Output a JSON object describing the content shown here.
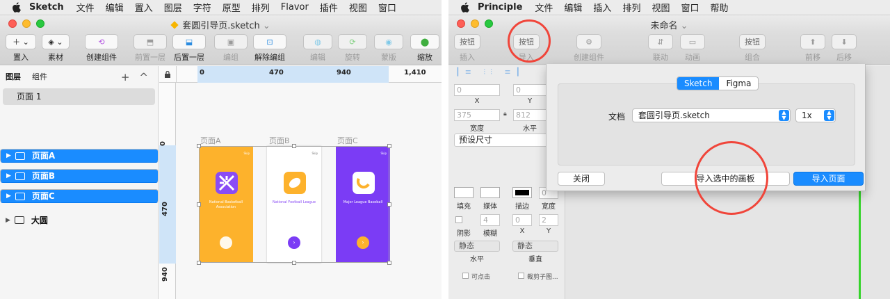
{
  "sketch": {
    "menubar": {
      "app": "Sketch",
      "items": [
        "文件",
        "编辑",
        "置入",
        "图层",
        "字符",
        "原型",
        "排列",
        "Flavor",
        "插件",
        "视图",
        "窗口"
      ]
    },
    "window": {
      "doc_title": "套圆引导页.sketch",
      "doc_chev": "⌄"
    },
    "toolbar": [
      {
        "label": "置入",
        "icon": "plus-icon",
        "enabled": true
      },
      {
        "label": "素材",
        "icon": "layers-icon",
        "enabled": true
      },
      {
        "label": "创建组件",
        "icon": "symbol-icon",
        "enabled": true
      },
      {
        "label": "前置一层",
        "icon": "bring-forward-icon",
        "enabled": false
      },
      {
        "label": "后置一层",
        "icon": "send-backward-icon",
        "enabled": true
      },
      {
        "label": "编组",
        "icon": "group-icon",
        "enabled": false
      },
      {
        "label": "解除编组",
        "icon": "ungroup-icon",
        "enabled": true
      },
      {
        "label": "编辑",
        "icon": "edit-icon",
        "enabled": false
      },
      {
        "label": "旋转",
        "icon": "rotate-icon",
        "enabled": false
      },
      {
        "label": "蒙版",
        "icon": "mask-icon",
        "enabled": false
      },
      {
        "label": "缩放",
        "icon": "scale-icon",
        "enabled": true
      }
    ],
    "sidebar": {
      "tabs": [
        "图层",
        "组件"
      ],
      "add": "+",
      "collapse": "^",
      "page": "页面 1",
      "layers": [
        {
          "name": "页面A",
          "selected": true
        },
        {
          "name": "页面B",
          "selected": true
        },
        {
          "name": "页面C",
          "selected": true
        },
        {
          "name": "大圆",
          "selected": false
        }
      ]
    },
    "ruler": {
      "h": [
        "0",
        "470",
        "940",
        "1,410"
      ],
      "v": [
        "0",
        "470",
        "940"
      ]
    },
    "artboards": [
      {
        "label": "页面A",
        "caption": "National Basketball Association",
        "bg": "#fdb22c",
        "skip": "Skip"
      },
      {
        "label": "页面B",
        "caption": "National Football League",
        "bg": "#ffffff",
        "skip": "Skip"
      },
      {
        "label": "页面C",
        "caption": "Major League Baseball",
        "bg": "#7b3cf5",
        "skip": "Skip"
      }
    ]
  },
  "principle": {
    "menubar": {
      "app": "Principle",
      "items": [
        "文件",
        "编辑",
        "插入",
        "排列",
        "视图",
        "窗口",
        "帮助"
      ]
    },
    "window": {
      "doc_title": "未命名",
      "doc_chev": "⌄"
    },
    "toolbar": [
      {
        "button": "按钮",
        "label": "插入"
      },
      {
        "button": "按钮",
        "label": "导入"
      },
      {
        "button": "",
        "label": "创建组件"
      },
      {
        "button": "",
        "label": "联动"
      },
      {
        "button": "",
        "label": "动画"
      },
      {
        "button": "按钮",
        "label": "组合"
      },
      {
        "button": "",
        "label": "前移"
      },
      {
        "button": "",
        "label": "后移"
      }
    ],
    "inspector": {
      "x": "0",
      "y": "0",
      "x_label": "X",
      "y_label": "Y",
      "w": "375",
      "h": "812",
      "w_label": "宽度",
      "h_label": "水平",
      "preset": "预设尺寸",
      "fill": "填充",
      "media": "媒体",
      "stroke": "描边",
      "stroke_w": "宽度",
      "stroke_val": "0",
      "shadow": "阴影",
      "blur": "模糊",
      "blur_val": "4",
      "sx": "0",
      "sy": "2",
      "sx_label": "X",
      "sy_label": "Y",
      "h_align": "静态",
      "v_align": "静态",
      "v_label": "垂直",
      "clickable": "可点击",
      "clip": "裁剪子图..."
    },
    "dialog": {
      "tabs": [
        "Sketch",
        "Figma"
      ],
      "active_tab": "Sketch",
      "doc_label": "文档",
      "doc_value": "套圆引导页.sketch",
      "scale": "1x",
      "close": "关闭",
      "import_selected": "导入选中的画板",
      "import_page": "导入页面"
    }
  },
  "colors": {
    "accent": "#1a8cff",
    "highlight_circle": "#f0453a",
    "green_line": "#35d42a"
  }
}
